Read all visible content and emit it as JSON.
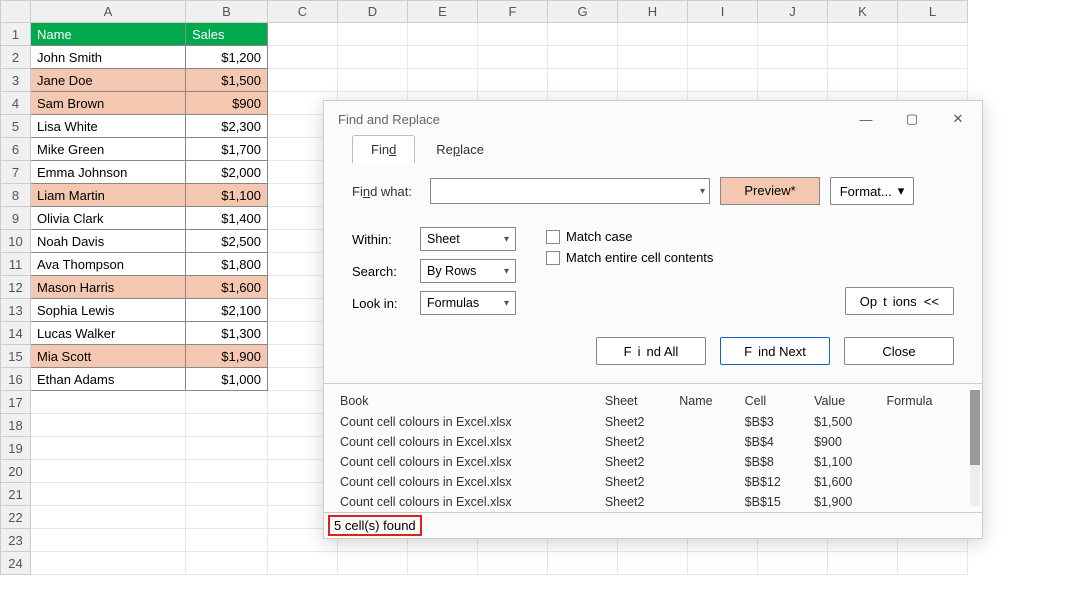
{
  "sheet": {
    "columns": [
      "A",
      "B",
      "C",
      "D",
      "E",
      "F",
      "G",
      "H",
      "I",
      "J",
      "K",
      "L"
    ],
    "headers": {
      "A": "Name",
      "B": "Sales"
    },
    "rows": [
      {
        "n": 1,
        "A": "Name",
        "B": "Sales",
        "header": true
      },
      {
        "n": 2,
        "A": "John Smith",
        "B": "$1,200"
      },
      {
        "n": 3,
        "A": "Jane Doe",
        "B": "$1,500",
        "hlA": true,
        "hlB": true
      },
      {
        "n": 4,
        "A": "Sam Brown",
        "B": "$900",
        "hlA": true,
        "hlB": true
      },
      {
        "n": 5,
        "A": "Lisa White",
        "B": "$2,300"
      },
      {
        "n": 6,
        "A": "Mike Green",
        "B": "$1,700"
      },
      {
        "n": 7,
        "A": "Emma Johnson",
        "B": "$2,000"
      },
      {
        "n": 8,
        "A": "Liam Martin",
        "B": "$1,100",
        "hlA": true,
        "hlB": true
      },
      {
        "n": 9,
        "A": "Olivia Clark",
        "B": "$1,400"
      },
      {
        "n": 10,
        "A": "Noah Davis",
        "B": "$2,500"
      },
      {
        "n": 11,
        "A": "Ava Thompson",
        "B": "$1,800"
      },
      {
        "n": 12,
        "A": "Mason Harris",
        "B": "$1,600",
        "hlA": true,
        "hlB": true
      },
      {
        "n": 13,
        "A": "Sophia Lewis",
        "B": "$2,100"
      },
      {
        "n": 14,
        "A": "Lucas Walker",
        "B": "$1,300"
      },
      {
        "n": 15,
        "A": "Mia Scott",
        "B": "$1,900",
        "hlA": true,
        "hlB": true
      },
      {
        "n": 16,
        "A": "Ethan Adams",
        "B": "$1,000"
      }
    ],
    "blank_rows": [
      17,
      18,
      19,
      20,
      21,
      22,
      23,
      24
    ]
  },
  "dialog": {
    "title": "Find and Replace",
    "tabs": {
      "find": "Find",
      "replace": "Replace"
    },
    "find_what_label": "Find what:",
    "find_what_value": "",
    "preview_label": "Preview*",
    "format_label": "Format...",
    "within": {
      "label": "Within:",
      "value": "Sheet"
    },
    "search": {
      "label": "Search:",
      "value": "By Rows"
    },
    "lookin": {
      "label": "Look in:",
      "value": "Formulas"
    },
    "check_matchcase": "Match case",
    "check_entire": "Match entire cell contents",
    "options_btn": "Options <<",
    "find_all_btn": "Find All",
    "find_next_btn": "Find Next",
    "close_btn": "Close",
    "results": {
      "headers": {
        "book": "Book",
        "sheet": "Sheet",
        "name": "Name",
        "cell": "Cell",
        "value": "Value",
        "formula": "Formula"
      },
      "rows": [
        {
          "book": "Count cell colours in Excel.xlsx",
          "sheet": "Sheet2",
          "name": "",
          "cell": "$B$3",
          "value": "$1,500",
          "formula": ""
        },
        {
          "book": "Count cell colours in Excel.xlsx",
          "sheet": "Sheet2",
          "name": "",
          "cell": "$B$4",
          "value": "$900",
          "formula": ""
        },
        {
          "book": "Count cell colours in Excel.xlsx",
          "sheet": "Sheet2",
          "name": "",
          "cell": "$B$8",
          "value": "$1,100",
          "formula": ""
        },
        {
          "book": "Count cell colours in Excel.xlsx",
          "sheet": "Sheet2",
          "name": "",
          "cell": "$B$12",
          "value": "$1,600",
          "formula": ""
        },
        {
          "book": "Count cell colours in Excel.xlsx",
          "sheet": "Sheet2",
          "name": "",
          "cell": "$B$15",
          "value": "$1,900",
          "formula": ""
        }
      ]
    },
    "status": "5 cell(s) found"
  }
}
